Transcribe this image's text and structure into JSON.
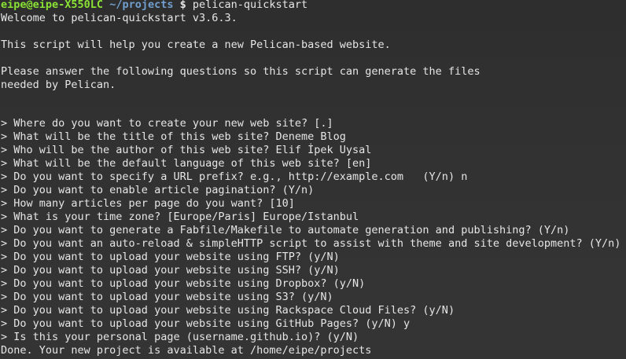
{
  "prompt": {
    "user_host": "eipe@eipe-X550LC",
    "cwd": "~/projects",
    "symbol": "$",
    "command": "pelican-quickstart"
  },
  "intro": {
    "welcome": "Welcome to pelican-quickstart v3.6.3.",
    "purpose": "This script will help you create a new Pelican-based website.",
    "instructions_1": "Please answer the following questions so this script can generate the files",
    "instructions_2": "needed by Pelican."
  },
  "questions": [
    "> Where do you want to create your new web site? [.]",
    "> What will be the title of this web site? Deneme Blog",
    "> Who will be the author of this web site? Elif İpek Uysal",
    "> What will be the default language of this web site? [en]",
    "> Do you want to specify a URL prefix? e.g., http://example.com   (Y/n) n",
    "> Do you want to enable article pagination? (Y/n)",
    "> How many articles per page do you want? [10]",
    "> What is your time zone? [Europe/Paris] Europe/Istanbul",
    "> Do you want to generate a Fabfile/Makefile to automate generation and publishing? (Y/n)",
    "> Do you want an auto-reload & simpleHTTP script to assist with theme and site development? (Y/n)",
    "> Do you want to upload your website using FTP? (y/N)",
    "> Do you want to upload your website using SSH? (y/N)",
    "> Do you want to upload your website using Dropbox? (y/N)",
    "> Do you want to upload your website using S3? (y/N)",
    "> Do you want to upload your website using Rackspace Cloud Files? (y/N)",
    "> Do you want to upload your website using GitHub Pages? (y/N) y",
    "> Is this your personal page (username.github.io)? (y/N)"
  ],
  "done": "Done. Your new project is available at /home/eipe/projects"
}
